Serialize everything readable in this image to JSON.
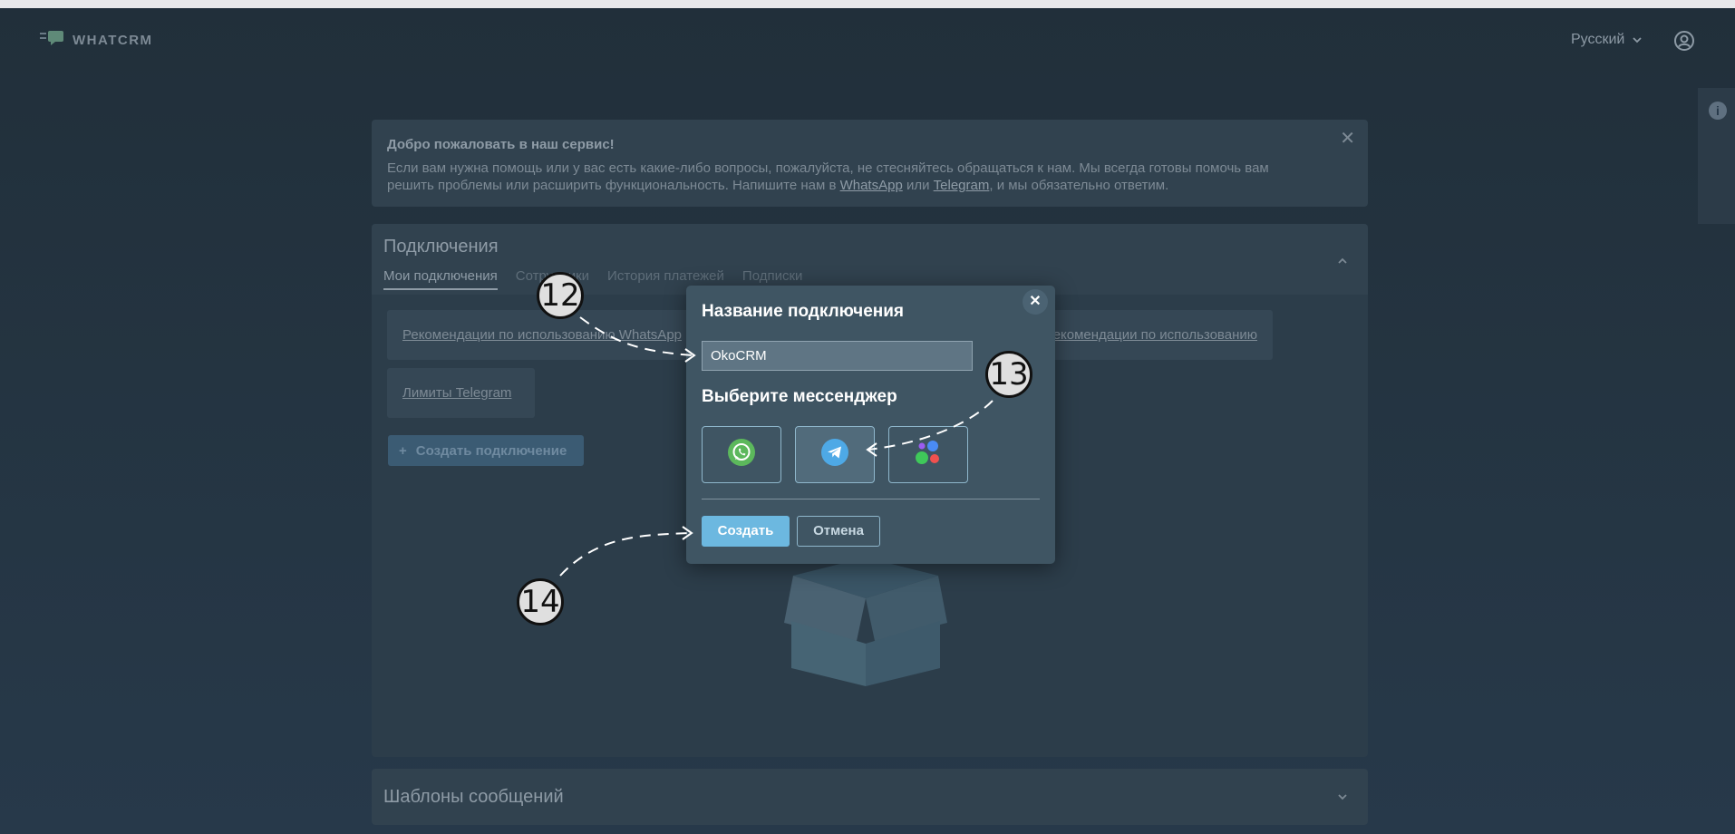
{
  "app": {
    "logo_text": "WHATCRM",
    "language": "Русский",
    "icons": {
      "logo": "chat-bubbles-logo-icon",
      "language_toggle": "chevron-down-icon",
      "profile": "user-circle-icon",
      "info": "info-icon"
    }
  },
  "welcome": {
    "title": "Добро пожаловать в наш сервис!",
    "text_before": "Если вам нужна помощь или у вас есть какие-либо вопросы, пожалуйста, не стесняйтесь обращаться к нам. Мы всегда готовы помочь вам решить проблемы или расширить функциональность. Напишите нам в ",
    "whatsapp_link": "WhatsApp",
    "text_or": " или ",
    "telegram_link": "Telegram",
    "text_after": ", и мы обязательно ответим.",
    "close": "✕"
  },
  "connections": {
    "title": "Подключения",
    "tabs": [
      "Мои подключения",
      "Сотрудники",
      "История платежей",
      "Подписки"
    ],
    "rec_whatsapp": "Рекомендации по использованию WhatsApp",
    "rec_telegram": "Рекомендации по использованию Telegram",
    "limits_telegram": "Лимиты Telegram",
    "create_button": "Создать подключение",
    "collapse_icon": "chevron-up-icon"
  },
  "templates": {
    "title": "Шаблоны сообщений",
    "expand_icon": "chevron-down-icon"
  },
  "modal": {
    "title": "Название подключения",
    "name_value": "OkoCRM",
    "subtitle": "Выберите мессенджер",
    "messengers": [
      "whatsapp-icon",
      "telegram-icon",
      "avito-icon"
    ],
    "selected_messenger": "telegram",
    "create_label": "Создать",
    "cancel_label": "Отмена",
    "close": "✕"
  },
  "annotations": [
    "12",
    "13",
    "14"
  ],
  "colors": {
    "whatsapp": "#5cb85c",
    "telegram": "#4ea9e6",
    "create_button": "#6cb8e0",
    "accent_border": "#8fb7cc"
  }
}
